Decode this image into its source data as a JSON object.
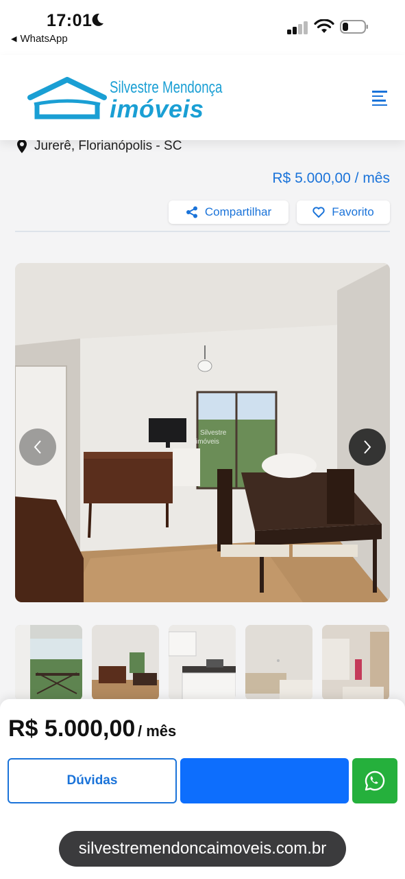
{
  "status_bar": {
    "time": "17:01",
    "back_app": "WhatsApp"
  },
  "header": {
    "logo_line1": "Silvestre Mendonça",
    "logo_line2": "imóveis",
    "brand_color": "#1a9fd4"
  },
  "listing": {
    "location": "Jurerê, Florianópolis - SC",
    "price_line": "R$ 5.000,00 / mês",
    "share_label": "Compartilhar",
    "favorite_label": "Favorito",
    "accent_color": "#1a73d9"
  },
  "gallery": {
    "watermark_line1": "Silvestre",
    "watermark_line2": "imóveis",
    "thumbnail_count": 5
  },
  "bottom_bar": {
    "price": "R$ 5.000,00",
    "per_month": "/ mês",
    "duvidas_label": "Dúvidas",
    "primary_color": "#0d6efd",
    "whatsapp_color": "#25b03c"
  },
  "browser": {
    "url": "silvestremendoncaimoveis.com.br"
  }
}
